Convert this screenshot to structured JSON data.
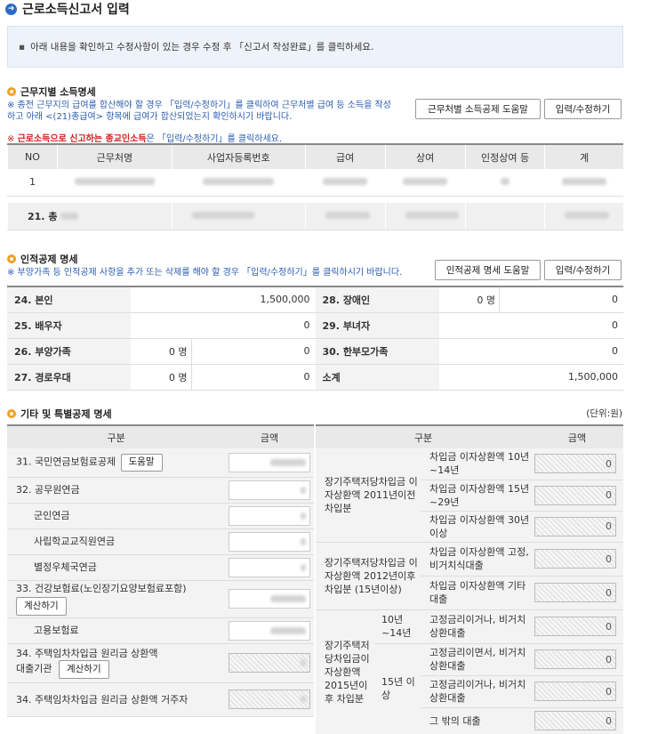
{
  "page": {
    "title": "근로소득신고서 입력",
    "notice": "아래 내용을 확인하고 수정사항이 있는 경우 수정 후 「신고서 작성완료」를 클릭하세요."
  },
  "work": {
    "title": "근무지별 소득명세",
    "note": "※ 종전 근무지의 급여를 합산해야 할 경우 「입력/수정하기」를 클릭하여 근무처별 급여 등 소득을 작성하고 아래 <(21)총급여> 항목에 급여가 합산되었는지 확인하시기 바랍니다.",
    "note_red_prefix": "※",
    "note_red_bold": "근로소득으로 신고하는 종교인소득",
    "note_red_suffix": "은 「입력/수정하기」를 클릭하세요.",
    "help_button": "근무처별 소득공제 도움말",
    "edit_button": "입력/수정하기",
    "columns": [
      "NO",
      "근무처명",
      "사업자등록번호",
      "급여",
      "상여",
      "인정상여 등",
      "계"
    ],
    "row_no": "1",
    "total_label": "21. 총"
  },
  "personal": {
    "title": "인적공제 명세",
    "note": "※ 부양가족 등 인적공제 사항을 추가 또는 삭제를 해야 할 경우 「입력/수정하기」를 클릭하시기 바랍니다.",
    "help_button": "인적공제 명세 도움말",
    "edit_button": "입력/수정하기",
    "rows": [
      {
        "l1": "24. 본인",
        "c1": "",
        "v1": "1,500,000",
        "l2": "28. 장애인",
        "c2": "0 명",
        "v2": "0"
      },
      {
        "l1": "25. 배우자",
        "c1": "",
        "v1": "0",
        "l2": "29. 부녀자",
        "c2": "",
        "v2": "0"
      },
      {
        "l1": "26. 부양가족",
        "c1": "0 명",
        "v1": "0",
        "l2": "30. 한부모가족",
        "c2": "",
        "v2": "0"
      },
      {
        "l1": "27. 경로우대",
        "c1": "0 명",
        "v1": "0",
        "l2": "소계",
        "c2": "",
        "v2": "1,500,000"
      }
    ]
  },
  "other": {
    "title": "기타 및 특별공제 명세",
    "unit": "(단위:원)",
    "col_item": "구분",
    "col_amount": "금액",
    "left": {
      "r31": "31. 국민연금보험료공제",
      "help": "도움말",
      "r32": "32. 공무원연금",
      "military": "군인연금",
      "school": "사립학교교직원연금",
      "postal": "별정우체국연금",
      "r33": "33. 건강보험료(노인장기요양보험료포함)",
      "calc": "계산하기",
      "employment": "고용보험료",
      "r34a_1": "34. 주택임차차입금 원리금 상환액",
      "r34a_2": "대출기관",
      "calc2": "계산하기",
      "r34b": "34. 주택임차차입금 원리금 상환액 거주자"
    },
    "right": {
      "grp1": "장기주택저당차입금 이자상환액 2011년이전 차입분",
      "i1": "차입금 이자상환액 10년~14년",
      "i2": "차입금 이자상환액 15년~29년",
      "i3": "차입금 이자상환액 30년 이상",
      "grp2": "장기주택저당차입금 이자상환액 2012년이후 차입분 (15년이상)",
      "i4": "차입금 이자상환액 고정,비거치식대출",
      "i5": "차입금 이자상환액 기타대출",
      "grp3": "장기주택저당차입금이자상환액 2015년이후 차입분",
      "sub1": "10년~14년",
      "i6": "고정금리이거나, 비거치상환대출",
      "sub2": "15년 이상",
      "i7": "고정금리이면서, 비거치상환대출",
      "i8": "고정금리이거나, 비거치상환대출",
      "i9": "그 밖의 대출",
      "zero": "0"
    }
  }
}
